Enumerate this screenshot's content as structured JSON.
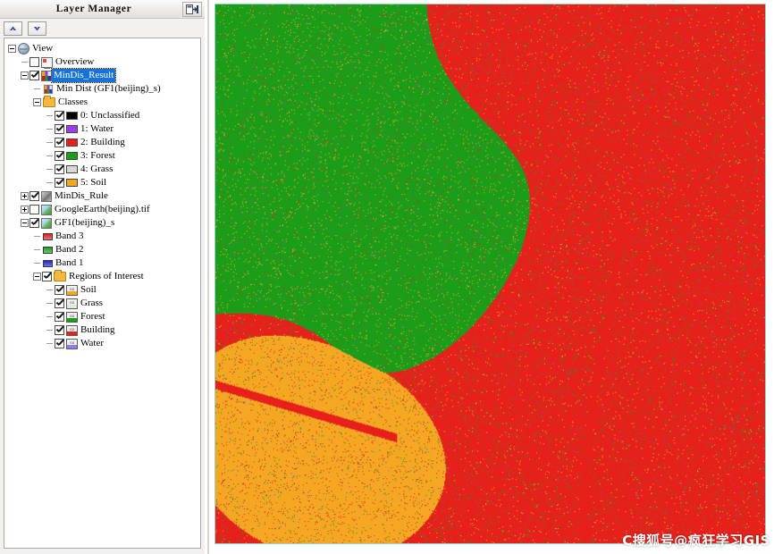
{
  "panel": {
    "title": "Layer Manager",
    "dock_button": "dock-icon",
    "toolbar": {
      "up_label": "move-up",
      "down_label": "move-down"
    }
  },
  "tree": {
    "root": {
      "label": "View",
      "icon": "globe-icon",
      "expanded": true
    },
    "nodes": [
      {
        "label": "Overview",
        "icon": "monitor-icon",
        "checked": false,
        "indent": 1
      },
      {
        "label": "MinDis_Result",
        "icon": "classification-icon",
        "checked": true,
        "selected": true,
        "expanded": true,
        "indent": 1
      },
      {
        "label": "Min Dist (GF1(beijing)_s)",
        "icon": "classification-icon",
        "indent": 2
      },
      {
        "label": "Classes",
        "icon": "folder-icon",
        "expanded": true,
        "indent": 2
      }
    ],
    "classes": [
      {
        "label": "0: Unclassified",
        "color": "#000000",
        "checked": true
      },
      {
        "label": "1: Water",
        "color": "#9a3fe8",
        "checked": true
      },
      {
        "label": "2: Building",
        "color": "#e8201c",
        "checked": true
      },
      {
        "label": "3: Forest",
        "color": "#1a9e1a",
        "checked": true
      },
      {
        "label": "4: Grass",
        "color": "#d8d8d8",
        "checked": true
      },
      {
        "label": "5: Soil",
        "color": "#f5a623",
        "checked": true
      }
    ],
    "layers": [
      {
        "label": "MinDis_Rule",
        "icon": "gray-raster-icon",
        "checked": true,
        "expandable": true
      },
      {
        "label": "GoogleEarth(beijing).tif",
        "icon": "raster-icon",
        "checked": false,
        "expandable": true
      },
      {
        "label": "GF1(beijing)_s",
        "icon": "raster-icon",
        "checked": true,
        "expanded": true
      }
    ],
    "bands": [
      {
        "label": "Band 3",
        "color": "#e02020"
      },
      {
        "label": "Band 2",
        "color": "#19a119"
      },
      {
        "label": "Band 1",
        "color": "#2222cc"
      }
    ],
    "roi_group": {
      "label": "Regions of Interest",
      "icon": "folder-icon",
      "checked": true,
      "expanded": true
    },
    "rois": [
      {
        "label": "Soil",
        "color": "#f5a623",
        "checked": true,
        "icon": "roi-icon"
      },
      {
        "label": "Grass",
        "color": "#d8f0d0",
        "checked": true,
        "icon": "roi-icon"
      },
      {
        "label": "Forest",
        "color": "#1a9e1a",
        "checked": true,
        "icon": "roi-icon"
      },
      {
        "label": "Building",
        "color": "#e8201c",
        "checked": true,
        "icon": "roi-icon"
      },
      {
        "label": "Water",
        "color": "#8f7fe8",
        "checked": true,
        "icon": "roi-icon"
      }
    ]
  },
  "map": {
    "watermark": "C搜狐号@疯狂学习GIS",
    "border_color": "#8ed6c8",
    "palette": {
      "unclassified": "#000000",
      "water": "#9a3fe8",
      "building": "#e8201c",
      "forest": "#1a9e1a",
      "grass": "#d8d8d8",
      "soil": "#f5a623"
    }
  }
}
